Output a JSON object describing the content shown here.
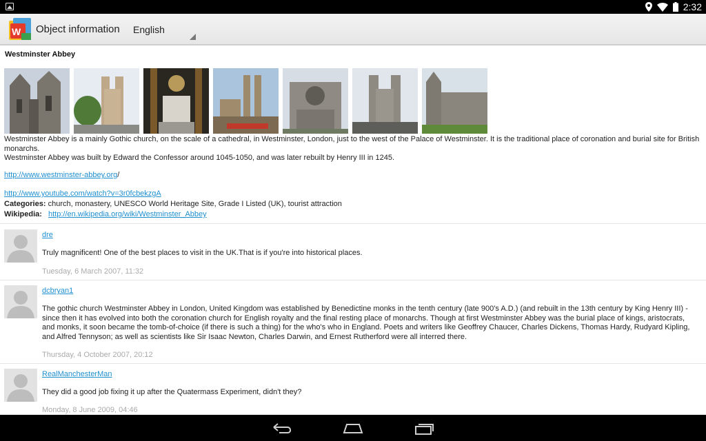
{
  "status_bar": {
    "time": "2:32",
    "icons": [
      "image-notification-icon",
      "location-icon",
      "wifi-icon",
      "battery-icon"
    ]
  },
  "action_bar": {
    "title": "Object information",
    "language": "English",
    "app_icon": "wikimapia-logo-icon"
  },
  "object": {
    "name": "Westminster Abbey",
    "photos": [
      {
        "name": "photo-1"
      },
      {
        "name": "photo-2"
      },
      {
        "name": "photo-3"
      },
      {
        "name": "photo-4"
      },
      {
        "name": "photo-5"
      },
      {
        "name": "photo-6"
      },
      {
        "name": "photo-7"
      }
    ],
    "description_1": "Westminster Abbey is a mainly Gothic church, on the scale of a cathedral, in Westminster, London, just to the west of the Palace of Westminster. It is the traditional place of coronation and burial site for British monarchs.",
    "description_2": "Westminster Abbey was built by Edward the Confessor around 1045-1050, and was later rebuilt by Henry III in 1245.",
    "link_1": "http://www.westminster-abbey.org",
    "link_1_suffix": "/",
    "link_2": "http://www.youtube.com/watch?v=3r0fcbekzgA",
    "categories_label": "Categories:",
    "categories": "church, monastery, UNESCO World Heritage Site, Grade I Listed (UK), tourist attraction",
    "wikipedia_label": "Wikipedia:",
    "wikipedia_link": "http://en.wikipedia.org/wiki/Westminster_Abbey"
  },
  "comments": [
    {
      "author": "dre",
      "text": "Truly magnificent! One of the best places to visit in the UK.That is if you're into historical places.",
      "date": "Tuesday, 6 March 2007, 11:32"
    },
    {
      "author": "dcbryan1",
      "text": "The gothic church Westminster Abbey in London, United Kingdom was established by Benedictine monks in the tenth century (late 900's A.D.) (and rebuilt in the 13th century by King Henry III) - since then it has evolved into both the coronation church for English royalty and the final resting place of monarchs. Though at first Westminster Abbey was the burial place of kings, aristocrats, and monks, it soon became the tomb-of-choice (if there is such a thing) for the who's who in England. Poets and writers like Geoffrey Chaucer, Charles Dickens, Thomas Hardy, Rudyard Kipling, and Alfred Tennyson; as well as scientists like Sir Isaac Newton, Charles Darwin, and Ernest Rutherford were all interred there.",
      "date": "Thursday, 4 October 2007, 20:12"
    },
    {
      "author": "RealManchesterMan",
      "text": "They did a good job fixing it up after the Quatermass Experiment, didn't they?",
      "date": "Monday, 8 June 2009, 04:46"
    }
  ],
  "nav_bar": {
    "icons": [
      "back-icon",
      "home-icon",
      "recent-apps-icon"
    ]
  },
  "colors": {
    "link": "#1e8fd0",
    "date": "#aaaaaa",
    "action_bar": "#ececec"
  }
}
